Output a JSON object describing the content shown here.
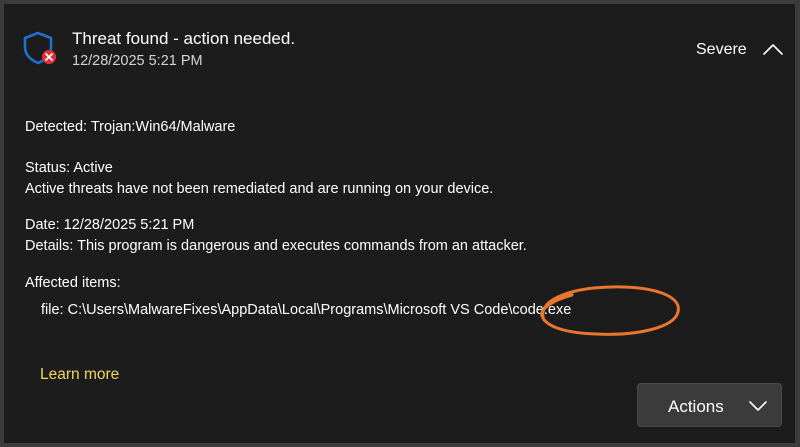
{
  "notification": {
    "title": "Threat found - action needed.",
    "timestamp": "12/28/2025 5:21 PM",
    "severity": "Severe",
    "icon": "shield-error-icon"
  },
  "details": {
    "detected": "Detected: Trojan:Win64/Malware",
    "status": "Status: Active",
    "status_description": "Active threats have not been remediated and are running on your device.",
    "date": "Date: 12/28/2025 5:21 PM",
    "details_text": "Details: This program is dangerous and executes commands from an attacker.",
    "affected_label": "Affected items:",
    "file_path": "file: C:\\Users\\MalwareFixes\\AppData\\Local\\Programs\\Microsoft VS Code\\code.exe"
  },
  "footer": {
    "learn_more": "Learn more",
    "actions_label": "Actions"
  },
  "colors": {
    "background": "#1c1c1c",
    "frame_border": "#3c3c3c",
    "shield_blue": "#1f6fd0",
    "error_red": "#e0303a",
    "link_yellow": "#f2d55a",
    "annotation_orange": "#e8762f",
    "button_bg": "#3b3b3b"
  }
}
